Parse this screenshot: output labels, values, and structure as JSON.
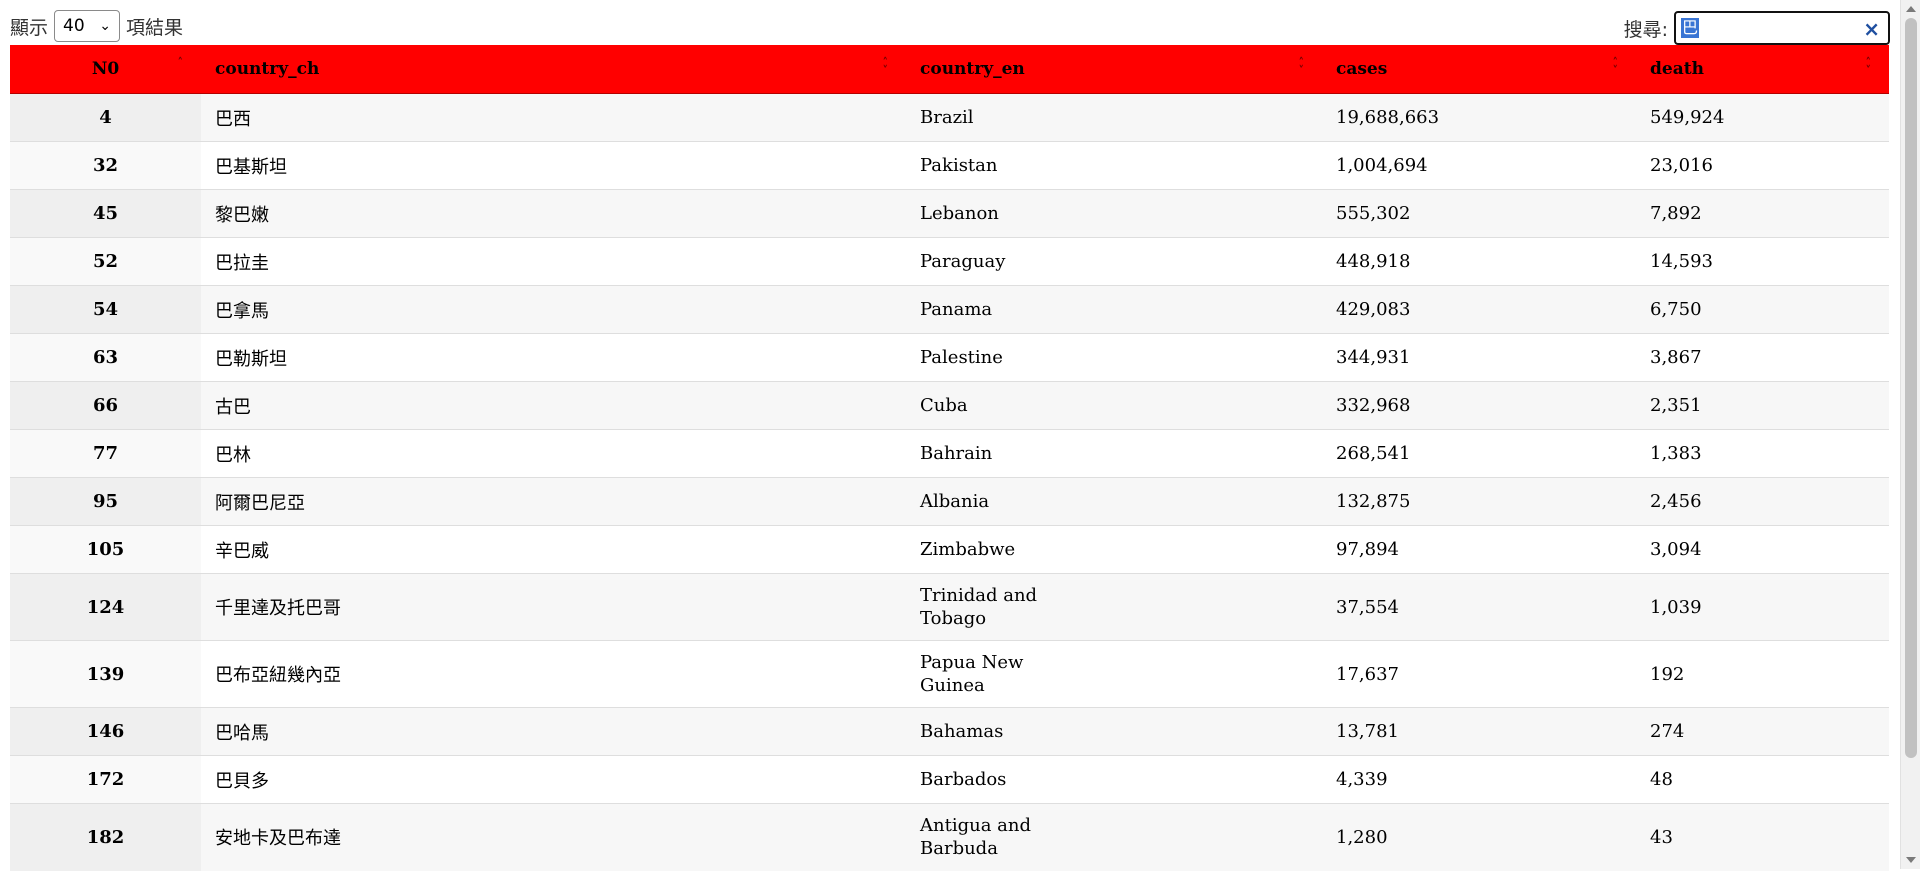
{
  "length_control": {
    "prefix": "顯示",
    "value": "40",
    "suffix": "項結果"
  },
  "search": {
    "label": "搜尋:",
    "value": "巴",
    "clear": "×"
  },
  "table": {
    "headers": [
      "N0",
      "country_ch",
      "country_en",
      "cases",
      "death"
    ],
    "sort_states": [
      "asc",
      "both",
      "both",
      "both",
      "both"
    ],
    "rows": [
      {
        "n0": "4",
        "country_ch": "巴西",
        "country_en": "Brazil",
        "cases": "19,688,663",
        "death": "549,924"
      },
      {
        "n0": "32",
        "country_ch": "巴基斯坦",
        "country_en": "Pakistan",
        "cases": "1,004,694",
        "death": "23,016"
      },
      {
        "n0": "45",
        "country_ch": "黎巴嫩",
        "country_en": "Lebanon",
        "cases": "555,302",
        "death": "7,892"
      },
      {
        "n0": "52",
        "country_ch": "巴拉圭",
        "country_en": "Paraguay",
        "cases": "448,918",
        "death": "14,593"
      },
      {
        "n0": "54",
        "country_ch": "巴拿馬",
        "country_en": "Panama",
        "cases": "429,083",
        "death": "6,750"
      },
      {
        "n0": "63",
        "country_ch": "巴勒斯坦",
        "country_en": "Palestine",
        "cases": "344,931",
        "death": "3,867"
      },
      {
        "n0": "66",
        "country_ch": "古巴",
        "country_en": "Cuba",
        "cases": "332,968",
        "death": "2,351"
      },
      {
        "n0": "77",
        "country_ch": "巴林",
        "country_en": "Bahrain",
        "cases": "268,541",
        "death": "1,383"
      },
      {
        "n0": "95",
        "country_ch": "阿爾巴尼亞",
        "country_en": "Albania",
        "cases": "132,875",
        "death": "2,456"
      },
      {
        "n0": "105",
        "country_ch": "辛巴威",
        "country_en": "Zimbabwe",
        "cases": "97,894",
        "death": "3,094"
      },
      {
        "n0": "124",
        "country_ch": "千里達及托巴哥",
        "country_en": "Trinidad and Tobago",
        "cases": "37,554",
        "death": "1,039"
      },
      {
        "n0": "139",
        "country_ch": "巴布亞紐幾內亞",
        "country_en": "Papua New Guinea",
        "cases": "17,637",
        "death": "192"
      },
      {
        "n0": "146",
        "country_ch": "巴哈馬",
        "country_en": "Bahamas",
        "cases": "13,781",
        "death": "274"
      },
      {
        "n0": "172",
        "country_ch": "巴貝多",
        "country_en": "Barbados",
        "cases": "4,339",
        "death": "48"
      },
      {
        "n0": "182",
        "country_ch": "安地卡及巴布達",
        "country_en": "Antigua and Barbuda",
        "cases": "1,280",
        "death": "43"
      }
    ]
  },
  "colors": {
    "header_bg": "#ff0000",
    "search_highlight": "#3a75d4",
    "clear_icon": "#1f4fa0"
  }
}
